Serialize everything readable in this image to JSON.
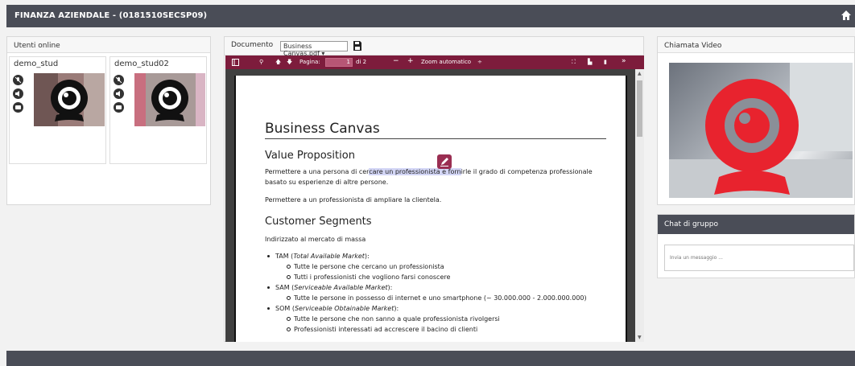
{
  "header": {
    "title": "FINANZA AZIENDALE - (0181510SECSP09)",
    "home_icon": "home-icon"
  },
  "users_panel": {
    "title": "Utenti online",
    "users": [
      {
        "name": "demo_stud"
      },
      {
        "name": "demo_stud02"
      }
    ]
  },
  "document_panel": {
    "label": "Documento",
    "selected_file": "Business Canvas.pdf ▾",
    "toolbar": {
      "page_label": "Pagina:",
      "page_value": "1",
      "page_total": "di 2",
      "zoom": "Zoom automatico",
      "zoom_caret": "÷"
    },
    "pdf": {
      "title": "Business Canvas",
      "sections": [
        {
          "heading": "Value Proposition",
          "paragraphs": [
            "Permettere a una persona di cercare un professionista e fornirle il grado di competenza professionale basato su esperienze di altre persone.",
            "Permettere a un professionista di ampliare la clientela."
          ],
          "highlight": {
            "before": "Permettere a una persona di cer",
            "marked": "care un professionista e forn",
            "after": "irle il grado di competenza professionale basato su esperienze di altre persone."
          }
        },
        {
          "heading": "Customer Segments",
          "intro": "Indirizzato al mercato di massa",
          "items": [
            {
              "label": "TAM (",
              "italic": "Total Available Market",
              "suffix": "):",
              "sub": [
                "Tutte le persone che cercano un professionista",
                "Tutti i professionisti che vogliono farsi conoscere"
              ]
            },
            {
              "label": "SAM (",
              "italic": "Serviceable Available Market",
              "suffix": "):",
              "sub": [
                "Tutte le persone in possesso di internet e uno smartphone (~ 30.000.000 - 2.000.000.000)"
              ]
            },
            {
              "label": "SOM (",
              "italic": "Serviceable Obtainable Market",
              "suffix": "):",
              "sub": [
                "Tutte le persone che non sanno a quale professionista rivolgersi",
                "Professionisti interessati ad accrescere il bacino di clienti"
              ]
            }
          ]
        }
      ]
    }
  },
  "video_panel": {
    "title": "Chiamata Video"
  },
  "chat_panel": {
    "title": "Chat di gruppo",
    "placeholder": "Invia un messaggio ..."
  },
  "colors": {
    "header_bg": "#4a4d57",
    "pdf_toolbar": "#7d1c3c",
    "webcam_red": "#e8232e"
  }
}
